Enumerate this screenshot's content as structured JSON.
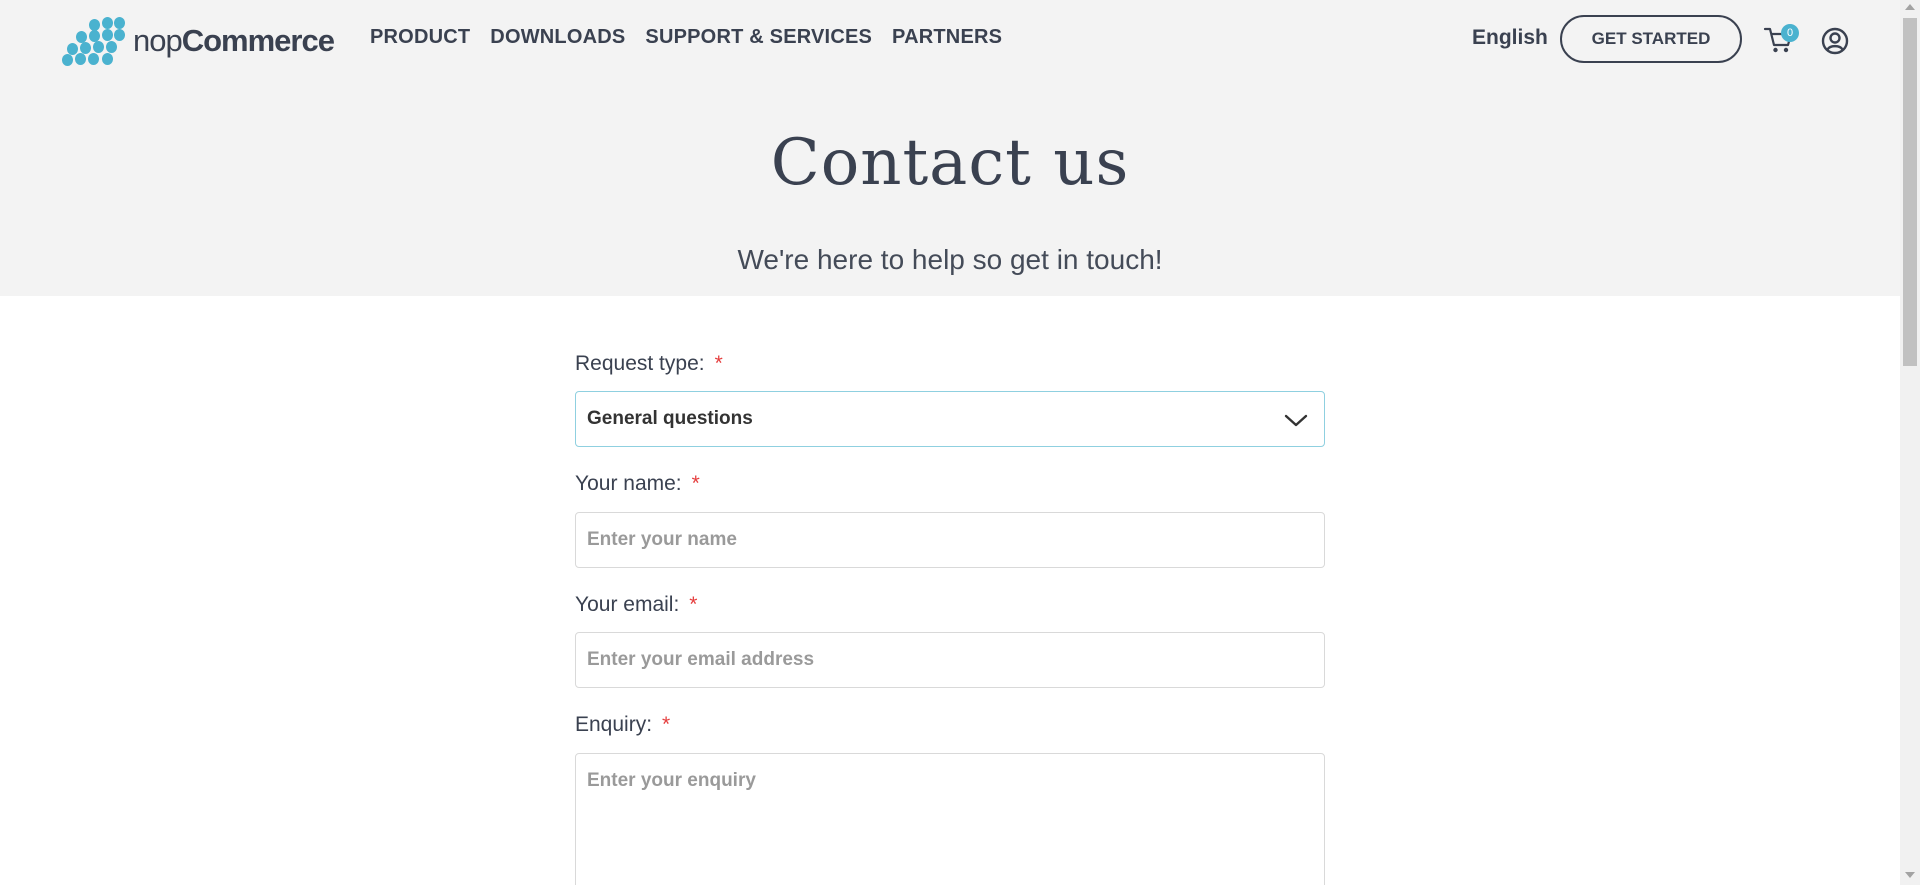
{
  "header": {
    "logo": {
      "light": "nop",
      "bold": "Commerce"
    },
    "nav": [
      "PRODUCT",
      "DOWNLOADS",
      "SUPPORT & SERVICES",
      "PARTNERS"
    ],
    "language": "English",
    "get_started": "GET STARTED",
    "cart_count": "0",
    "icons": {
      "cart": "cart-icon",
      "account": "user-circle-icon",
      "dropdown": "chevron-down-icon"
    }
  },
  "hero": {
    "title": "Contact us",
    "subtitle": "We're here to help so get in touch!"
  },
  "form": {
    "request_type": {
      "label": "Request type:",
      "required": "*",
      "value": "General questions"
    },
    "name": {
      "label": "Your name:",
      "required": "*",
      "placeholder": "Enter your name",
      "value": ""
    },
    "email": {
      "label": "Your email:",
      "required": "*",
      "placeholder": "Enter your email address",
      "value": ""
    },
    "enquiry": {
      "label": "Enquiry:",
      "required": "*",
      "placeholder": "Enter your enquiry",
      "value": ""
    }
  },
  "colors": {
    "accent": "#4ab2cf",
    "text_dark": "#3a4150",
    "required": "#e53e3e",
    "hero_bg": "#f3f3f3"
  }
}
